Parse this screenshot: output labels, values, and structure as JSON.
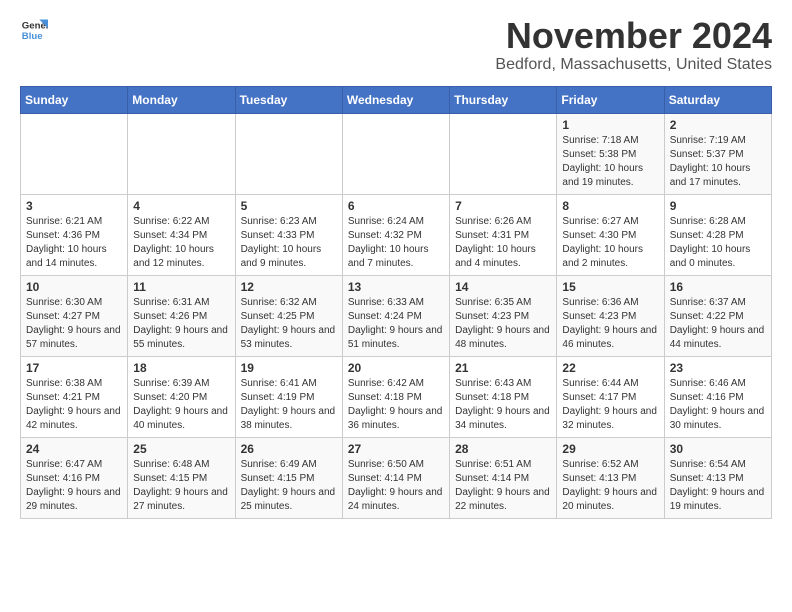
{
  "logo": {
    "general": "General",
    "blue": "Blue"
  },
  "title": "November 2024",
  "location": "Bedford, Massachusetts, United States",
  "days_header": [
    "Sunday",
    "Monday",
    "Tuesday",
    "Wednesday",
    "Thursday",
    "Friday",
    "Saturday"
  ],
  "weeks": [
    [
      {
        "day": "",
        "info": ""
      },
      {
        "day": "",
        "info": ""
      },
      {
        "day": "",
        "info": ""
      },
      {
        "day": "",
        "info": ""
      },
      {
        "day": "",
        "info": ""
      },
      {
        "day": "1",
        "info": "Sunrise: 7:18 AM\nSunset: 5:38 PM\nDaylight: 10 hours and 19 minutes."
      },
      {
        "day": "2",
        "info": "Sunrise: 7:19 AM\nSunset: 5:37 PM\nDaylight: 10 hours and 17 minutes."
      }
    ],
    [
      {
        "day": "3",
        "info": "Sunrise: 6:21 AM\nSunset: 4:36 PM\nDaylight: 10 hours and 14 minutes."
      },
      {
        "day": "4",
        "info": "Sunrise: 6:22 AM\nSunset: 4:34 PM\nDaylight: 10 hours and 12 minutes."
      },
      {
        "day": "5",
        "info": "Sunrise: 6:23 AM\nSunset: 4:33 PM\nDaylight: 10 hours and 9 minutes."
      },
      {
        "day": "6",
        "info": "Sunrise: 6:24 AM\nSunset: 4:32 PM\nDaylight: 10 hours and 7 minutes."
      },
      {
        "day": "7",
        "info": "Sunrise: 6:26 AM\nSunset: 4:31 PM\nDaylight: 10 hours and 4 minutes."
      },
      {
        "day": "8",
        "info": "Sunrise: 6:27 AM\nSunset: 4:30 PM\nDaylight: 10 hours and 2 minutes."
      },
      {
        "day": "9",
        "info": "Sunrise: 6:28 AM\nSunset: 4:28 PM\nDaylight: 10 hours and 0 minutes."
      }
    ],
    [
      {
        "day": "10",
        "info": "Sunrise: 6:30 AM\nSunset: 4:27 PM\nDaylight: 9 hours and 57 minutes."
      },
      {
        "day": "11",
        "info": "Sunrise: 6:31 AM\nSunset: 4:26 PM\nDaylight: 9 hours and 55 minutes."
      },
      {
        "day": "12",
        "info": "Sunrise: 6:32 AM\nSunset: 4:25 PM\nDaylight: 9 hours and 53 minutes."
      },
      {
        "day": "13",
        "info": "Sunrise: 6:33 AM\nSunset: 4:24 PM\nDaylight: 9 hours and 51 minutes."
      },
      {
        "day": "14",
        "info": "Sunrise: 6:35 AM\nSunset: 4:23 PM\nDaylight: 9 hours and 48 minutes."
      },
      {
        "day": "15",
        "info": "Sunrise: 6:36 AM\nSunset: 4:23 PM\nDaylight: 9 hours and 46 minutes."
      },
      {
        "day": "16",
        "info": "Sunrise: 6:37 AM\nSunset: 4:22 PM\nDaylight: 9 hours and 44 minutes."
      }
    ],
    [
      {
        "day": "17",
        "info": "Sunrise: 6:38 AM\nSunset: 4:21 PM\nDaylight: 9 hours and 42 minutes."
      },
      {
        "day": "18",
        "info": "Sunrise: 6:39 AM\nSunset: 4:20 PM\nDaylight: 9 hours and 40 minutes."
      },
      {
        "day": "19",
        "info": "Sunrise: 6:41 AM\nSunset: 4:19 PM\nDaylight: 9 hours and 38 minutes."
      },
      {
        "day": "20",
        "info": "Sunrise: 6:42 AM\nSunset: 4:18 PM\nDaylight: 9 hours and 36 minutes."
      },
      {
        "day": "21",
        "info": "Sunrise: 6:43 AM\nSunset: 4:18 PM\nDaylight: 9 hours and 34 minutes."
      },
      {
        "day": "22",
        "info": "Sunrise: 6:44 AM\nSunset: 4:17 PM\nDaylight: 9 hours and 32 minutes."
      },
      {
        "day": "23",
        "info": "Sunrise: 6:46 AM\nSunset: 4:16 PM\nDaylight: 9 hours and 30 minutes."
      }
    ],
    [
      {
        "day": "24",
        "info": "Sunrise: 6:47 AM\nSunset: 4:16 PM\nDaylight: 9 hours and 29 minutes."
      },
      {
        "day": "25",
        "info": "Sunrise: 6:48 AM\nSunset: 4:15 PM\nDaylight: 9 hours and 27 minutes."
      },
      {
        "day": "26",
        "info": "Sunrise: 6:49 AM\nSunset: 4:15 PM\nDaylight: 9 hours and 25 minutes."
      },
      {
        "day": "27",
        "info": "Sunrise: 6:50 AM\nSunset: 4:14 PM\nDaylight: 9 hours and 24 minutes."
      },
      {
        "day": "28",
        "info": "Sunrise: 6:51 AM\nSunset: 4:14 PM\nDaylight: 9 hours and 22 minutes."
      },
      {
        "day": "29",
        "info": "Sunrise: 6:52 AM\nSunset: 4:13 PM\nDaylight: 9 hours and 20 minutes."
      },
      {
        "day": "30",
        "info": "Sunrise: 6:54 AM\nSunset: 4:13 PM\nDaylight: 9 hours and 19 minutes."
      }
    ]
  ]
}
